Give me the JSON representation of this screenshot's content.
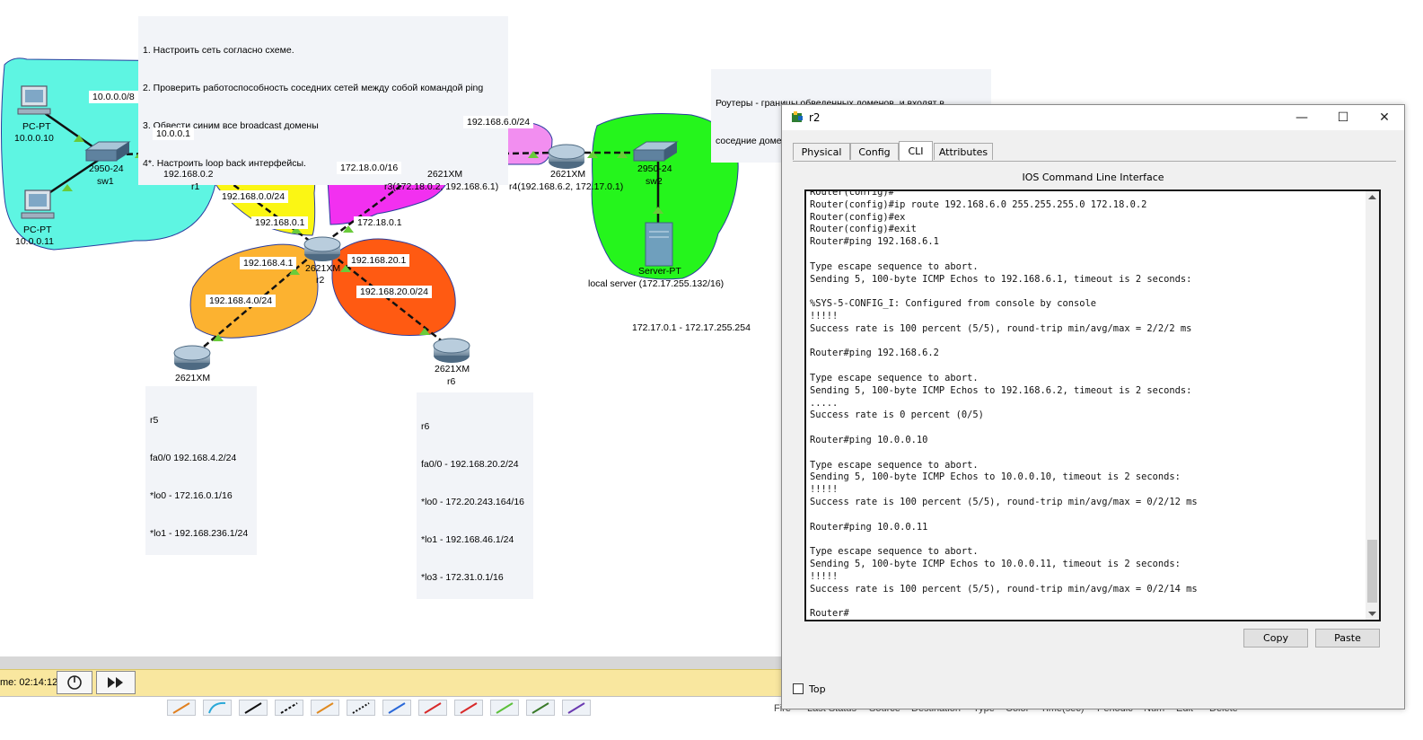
{
  "instructions": [
    "1. Настроить сеть согласно схеме.",
    "2. Проверить работоспособность соседних сетей между собой командой ping",
    "3. Обвести синим все broadcast домены",
    "4*. Настроить loop back интерфейсы."
  ],
  "note_routers": [
    "Роутеры - границы обведенных доменов, и входят в",
    "соседние домены с помощью интерфейсов  разных портов"
  ],
  "devices": {
    "pc1": {
      "type": "PC-PT",
      "ip": "10.0.0.10"
    },
    "pc2": {
      "type": "PC-PT",
      "ip": "10.0.0.11"
    },
    "sw1": {
      "model": "2950-24",
      "name": "sw1"
    },
    "r1": {
      "ip": "192.168.0.2",
      "name": "r1"
    },
    "r2": {
      "model": "2621XM",
      "name": "r2"
    },
    "r3": {
      "model": "2621XM",
      "label": "r3(172.18.0.2, 192.168.6.1)"
    },
    "r4": {
      "model": "2621XM",
      "label": "r4(192.168.6.2, 172.17.0.1)"
    },
    "sw2": {
      "model": "2950-24",
      "name": "sw2"
    },
    "server": {
      "type": "Server-PT",
      "label": "local server (172.17.255.132/16)"
    },
    "r5": {
      "model": "2621XM"
    },
    "r6": {
      "model": "2621XM",
      "name": "r6"
    }
  },
  "link_labels": {
    "net_10": "10.0.0.0/8",
    "r1_gw": "10.0.0.1",
    "net_192_0": "192.168.0.0/24",
    "r2_192_0": "192.168.0.1",
    "net_172_18": "172.18.0.0/16",
    "r2_172_18": "172.18.0.1",
    "net_192_6": "192.168.6.0/24",
    "r2_192_4": "192.168.4.1",
    "net_192_4": "192.168.4.0/24",
    "r2_192_20": "192.168.20.1",
    "net_192_20": "192.168.20.0/24",
    "range_172_17": "172.17.0.1 - 172.17.255.254"
  },
  "r5_note": [
    "r5",
    "fa0/0 192.168.4.2/24",
    "*lo0 - 172.16.0.1/16",
    "*lo1 - 192.168.236.1/24"
  ],
  "r6_note": [
    "r6",
    "fa0/0 - 192.168.20.2/24",
    "*lo0 - 172.20.243.164/16",
    "*lo1 - 192.168.46.1/24",
    "*lo3 - 172.31.0.1/16"
  ],
  "sim": {
    "time": "me: 02:14:12"
  },
  "pdu_headers": [
    "Fire",
    "Last Status",
    "Source",
    "Destination",
    "Type",
    "Color",
    "Time(sec)",
    "Periodic",
    "Num",
    "Edit",
    "Delete"
  ],
  "window": {
    "title": "r2",
    "tabs": [
      "Physical",
      "Config",
      "CLI",
      "Attributes"
    ],
    "active_tab": "CLI",
    "ios_title": "IOS Command Line Interface",
    "cli_lines": [
      "Router(config)#",
      "Router(config)#ip route 192.168.6.0 255.255.255.0 172.18.0.2",
      "Router(config)#ex",
      "Router(config)#exit",
      "Router#ping 192.168.6.1",
      "",
      "Type escape sequence to abort.",
      "Sending 5, 100-byte ICMP Echos to 192.168.6.1, timeout is 2 seconds:",
      "",
      "%SYS-5-CONFIG_I: Configured from console by console",
      "!!!!!",
      "Success rate is 100 percent (5/5), round-trip min/avg/max = 2/2/2 ms",
      "",
      "Router#ping 192.168.6.2",
      "",
      "Type escape sequence to abort.",
      "Sending 5, 100-byte ICMP Echos to 192.168.6.2, timeout is 2 seconds:",
      ".....",
      "Success rate is 0 percent (0/5)",
      "",
      "Router#ping 10.0.0.10",
      "",
      "Type escape sequence to abort.",
      "Sending 5, 100-byte ICMP Echos to 10.0.0.10, timeout is 2 seconds:",
      "!!!!!",
      "Success rate is 100 percent (5/5), round-trip min/avg/max = 0/2/12 ms",
      "",
      "Router#ping 10.0.0.11",
      "",
      "Type escape sequence to abort.",
      "Sending 5, 100-byte ICMP Echos to 10.0.0.11, timeout is 2 seconds:",
      "!!!!!",
      "Success rate is 100 percent (5/5), round-trip min/avg/max = 0/2/14 ms",
      "",
      "Router#"
    ],
    "copy_label": "Copy",
    "paste_label": "Paste",
    "top_label": "Top"
  },
  "colors": {
    "domain_cyan": "#5ef5e2",
    "domain_yellow": "#fbf614",
    "domain_magenta": "#f230f0",
    "domain_pink": "#f28ef0",
    "domain_green": "#25f51c",
    "domain_orange": "#fcb230",
    "domain_red_orange": "#ff5a12",
    "link_up": "#6acb3a"
  }
}
